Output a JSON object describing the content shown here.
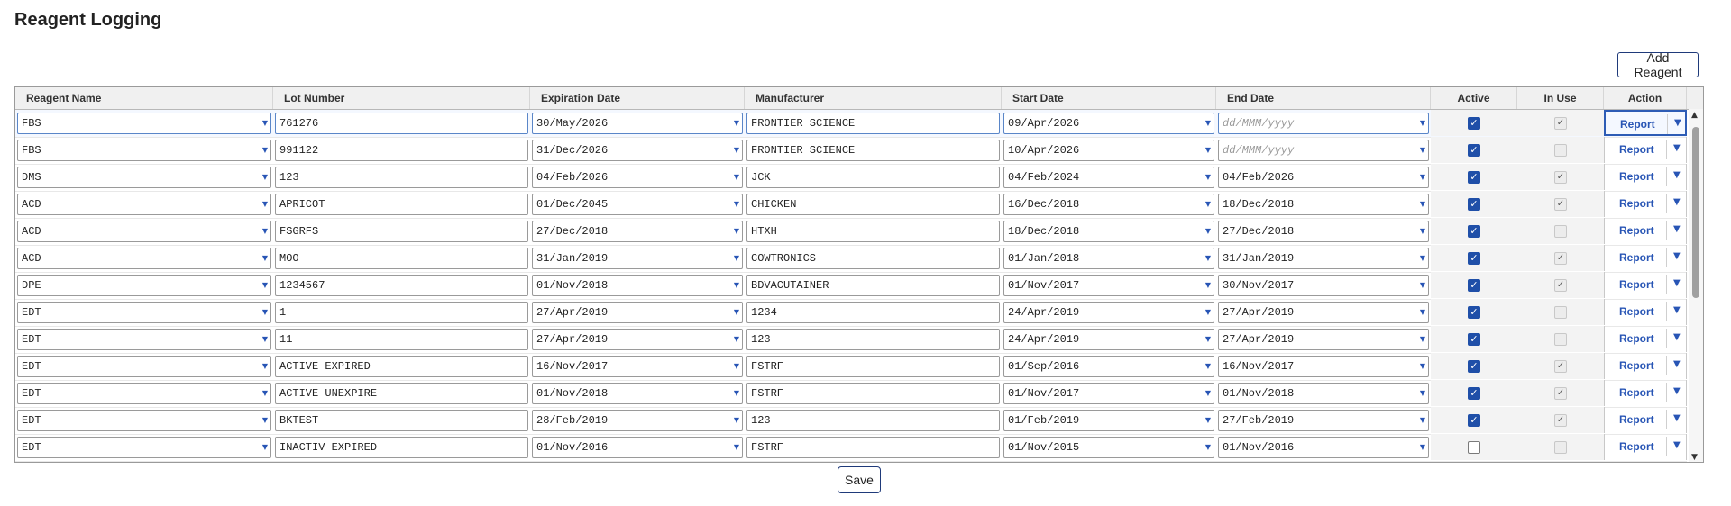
{
  "page": {
    "title": "Reagent Logging"
  },
  "toolbar": {
    "add_label": "Add Reagent"
  },
  "footer": {
    "save_label": "Save"
  },
  "grid": {
    "columns": [
      "Reagent Name",
      "Lot Number",
      "Expiration Date",
      "Manufacturer",
      "Start Date",
      "End Date",
      "Active",
      "In Use",
      "Action"
    ],
    "date_placeholder": "dd/MMM/yyyy",
    "action_label": "Report",
    "rows": [
      {
        "name": "FBS",
        "lot": "761276",
        "exp": "30/May/2026",
        "mfr": "FRONTIER SCIENCE",
        "start": "09/Apr/2026",
        "end": "",
        "active": true,
        "in_use": true
      },
      {
        "name": "FBS",
        "lot": "991122",
        "exp": "31/Dec/2026",
        "mfr": "FRONTIER SCIENCE",
        "start": "10/Apr/2026",
        "end": "",
        "active": true,
        "in_use": false
      },
      {
        "name": "DMS",
        "lot": "123",
        "exp": "04/Feb/2026",
        "mfr": "JCK",
        "start": "04/Feb/2024",
        "end": "04/Feb/2026",
        "active": true,
        "in_use": true
      },
      {
        "name": "ACD",
        "lot": "APRICOT",
        "exp": "01/Dec/2045",
        "mfr": "CHICKEN",
        "start": "16/Dec/2018",
        "end": "18/Dec/2018",
        "active": true,
        "in_use": true
      },
      {
        "name": "ACD",
        "lot": "FSGRFS",
        "exp": "27/Dec/2018",
        "mfr": "HTXH",
        "start": "18/Dec/2018",
        "end": "27/Dec/2018",
        "active": true,
        "in_use": false
      },
      {
        "name": "ACD",
        "lot": "MOO",
        "exp": "31/Jan/2019",
        "mfr": "COWTRONICS",
        "start": "01/Jan/2018",
        "end": "31/Jan/2019",
        "active": true,
        "in_use": true
      },
      {
        "name": "DPE",
        "lot": "1234567",
        "exp": "01/Nov/2018",
        "mfr": "BDVACUTAINER",
        "start": "01/Nov/2017",
        "end": "30/Nov/2017",
        "active": true,
        "in_use": true
      },
      {
        "name": "EDT",
        "lot": "1",
        "exp": "27/Apr/2019",
        "mfr": "1234",
        "start": "24/Apr/2019",
        "end": "27/Apr/2019",
        "active": true,
        "in_use": false
      },
      {
        "name": "EDT",
        "lot": "11",
        "exp": "27/Apr/2019",
        "mfr": "123",
        "start": "24/Apr/2019",
        "end": "27/Apr/2019",
        "active": true,
        "in_use": false
      },
      {
        "name": "EDT",
        "lot": "ACTIVE EXPIRED",
        "exp": "16/Nov/2017",
        "mfr": "FSTRF",
        "start": "01/Sep/2016",
        "end": "16/Nov/2017",
        "active": true,
        "in_use": true
      },
      {
        "name": "EDT",
        "lot": "ACTIVE UNEXPIRE",
        "exp": "01/Nov/2018",
        "mfr": "FSTRF",
        "start": "01/Nov/2017",
        "end": "01/Nov/2018",
        "active": true,
        "in_use": true
      },
      {
        "name": "EDT",
        "lot": "BKTEST",
        "exp": "28/Feb/2019",
        "mfr": "123",
        "start": "01/Feb/2019",
        "end": "27/Feb/2019",
        "active": true,
        "in_use": true
      },
      {
        "name": "EDT",
        "lot": "INACTIV EXPIRED",
        "exp": "01/Nov/2016",
        "mfr": "FSTRF",
        "start": "01/Nov/2015",
        "end": "01/Nov/2016",
        "active": false,
        "in_use": false
      }
    ]
  }
}
